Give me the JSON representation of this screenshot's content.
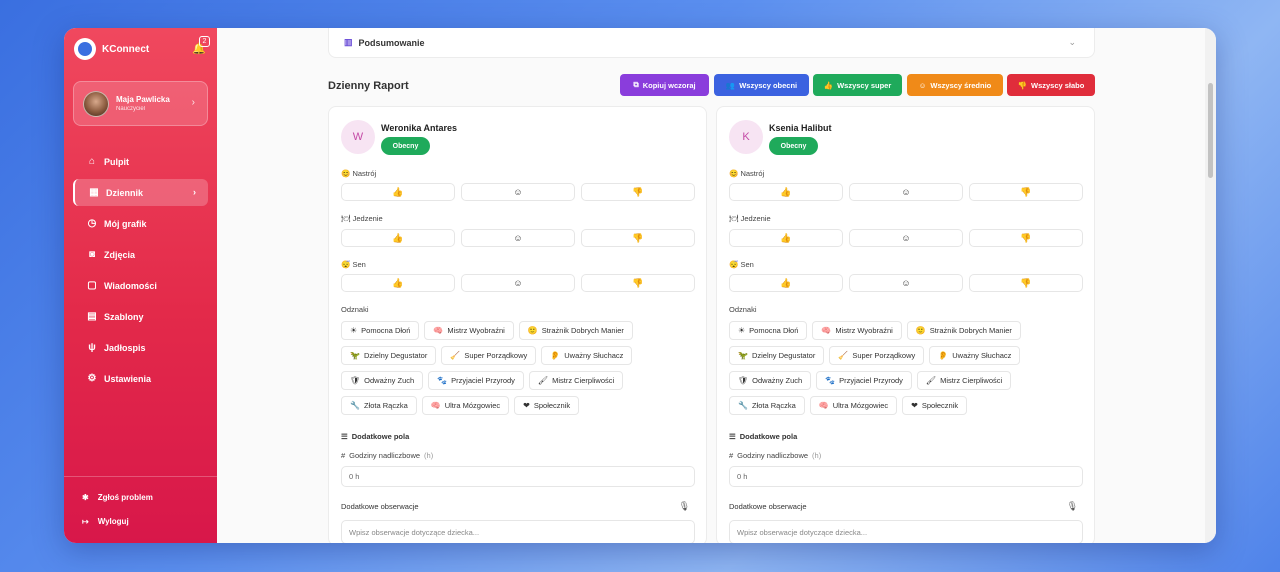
{
  "app": {
    "name": "KConnect",
    "notifications": "2"
  },
  "profile": {
    "name": "Maja Pawlicka",
    "role": "Nauczyciel"
  },
  "nav": [
    {
      "label": "Pulpit",
      "icon": "home-icon"
    },
    {
      "label": "Dziennik",
      "icon": "calendar-icon",
      "active": true
    },
    {
      "label": "Mój grafik",
      "icon": "clock-icon"
    },
    {
      "label": "Zdjęcia",
      "icon": "camera-icon"
    },
    {
      "label": "Wiadomości",
      "icon": "message-icon"
    },
    {
      "label": "Szablony",
      "icon": "template-icon"
    },
    {
      "label": "Jadłospis",
      "icon": "utensils-icon"
    },
    {
      "label": "Ustawienia",
      "icon": "gear-icon"
    }
  ],
  "bottom": {
    "report": "Zgłoś problem",
    "logout": "Wyloguj"
  },
  "summary": {
    "label": "Podsumowanie"
  },
  "report": {
    "title": "Dzienny Raport"
  },
  "actions": [
    {
      "label": "Kopiuj wczoraj",
      "color": "#8a3ddc"
    },
    {
      "label": "Wszyscy obecni",
      "color": "#3b62e0"
    },
    {
      "label": "Wszyscy super",
      "color": "#1faa5b"
    },
    {
      "label": "Wszyscy średnio",
      "color": "#f08a18"
    },
    {
      "label": "Wszyscy słabo",
      "color": "#e02d3b"
    }
  ],
  "sections": {
    "mood": "Nastrój",
    "food": "Jedzenie",
    "sleep": "Sen",
    "badges": "Odznaki",
    "extra": "Dodatkowe pola",
    "hours": "Godziny nadliczbowe",
    "hours_unit": "(h)",
    "hours_value": "0 h",
    "observations": "Dodatkowe obserwacje",
    "observations_placeholder": "Wpisz obserwacje dotyczące dziecka..."
  },
  "badges": [
    [
      "Pomocna Dłoń",
      "Mistrz Wyobraźni",
      "Strażnik Dobrych Manier"
    ],
    [
      "Dzielny Degustator",
      "Super Porządkowy",
      "Uważny Słuchacz"
    ],
    [
      "Odważny Zuch",
      "Przyjaciel Przyrody",
      "Mistrz Cierpliwości"
    ],
    [
      "Złota Rączka",
      "Ultra Mózgowiec",
      "Społecznik"
    ]
  ],
  "badge_emojis": [
    [
      "☀",
      "🧠",
      "🙂"
    ],
    [
      "🦖",
      "🧹",
      "👂"
    ],
    [
      "🛡",
      "🐾",
      "🖌"
    ],
    [
      "🔧",
      "🧠",
      "❤"
    ]
  ],
  "children": [
    {
      "initial": "W",
      "name": "Weronika Antares",
      "status": "Obecny"
    },
    {
      "initial": "K",
      "name": "Ksenia Halibut",
      "status": "Obecny"
    }
  ]
}
